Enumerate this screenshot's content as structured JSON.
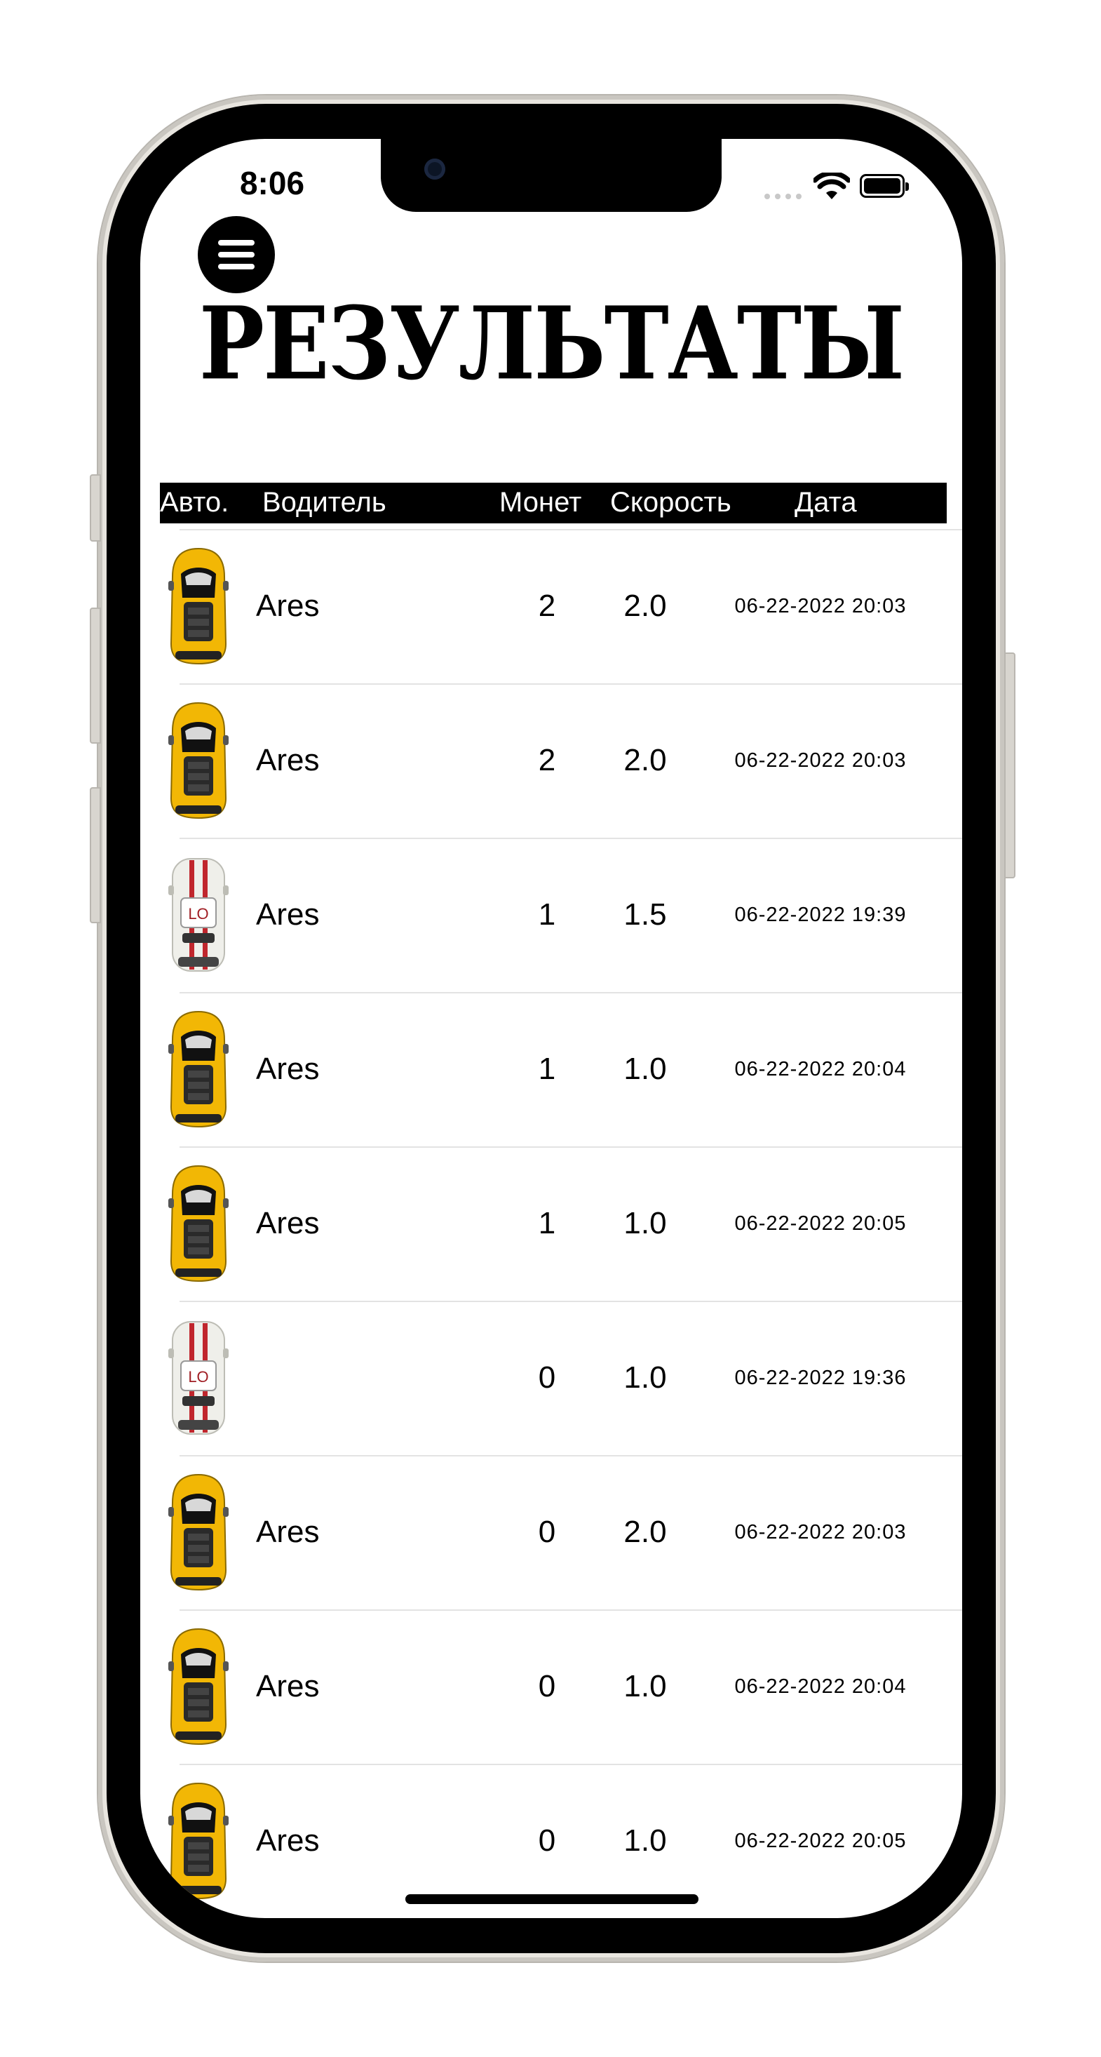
{
  "status_bar": {
    "time": "8:06"
  },
  "screen": {
    "title": "РЕЗУЛЬТАТЫ"
  },
  "table": {
    "headers": {
      "car": "Авто.",
      "driver": "Водитель",
      "coins": "Монет",
      "speed": "Скорость",
      "date": "Дата"
    },
    "rows": [
      {
        "car": "yellow-car",
        "driver": "Ares",
        "coins": "2",
        "speed": "2.0",
        "date": "06-22-2022 20:03"
      },
      {
        "car": "yellow-car",
        "driver": "Ares",
        "coins": "2",
        "speed": "2.0",
        "date": "06-22-2022 20:03"
      },
      {
        "car": "white-car",
        "driver": "Ares",
        "coins": "1",
        "speed": "1.5",
        "date": "06-22-2022 19:39"
      },
      {
        "car": "yellow-car",
        "driver": "Ares",
        "coins": "1",
        "speed": "1.0",
        "date": "06-22-2022 20:04"
      },
      {
        "car": "yellow-car",
        "driver": "Ares",
        "coins": "1",
        "speed": "1.0",
        "date": "06-22-2022 20:05"
      },
      {
        "car": "white-car",
        "driver": "",
        "coins": "0",
        "speed": "1.0",
        "date": "06-22-2022 19:36"
      },
      {
        "car": "yellow-car",
        "driver": "Ares",
        "coins": "0",
        "speed": "2.0",
        "date": "06-22-2022 20:03"
      },
      {
        "car": "yellow-car",
        "driver": "Ares",
        "coins": "0",
        "speed": "1.0",
        "date": "06-22-2022 20:04"
      },
      {
        "car": "yellow-car",
        "driver": "Ares",
        "coins": "0",
        "speed": "1.0",
        "date": "06-22-2022 20:05"
      }
    ]
  },
  "car_badges": {
    "white-car": "LO"
  },
  "colors": {
    "yellow_car": "#f2b705",
    "white_car": "#efefea",
    "stripe": "#c0262d",
    "header_bg": "#000000"
  }
}
